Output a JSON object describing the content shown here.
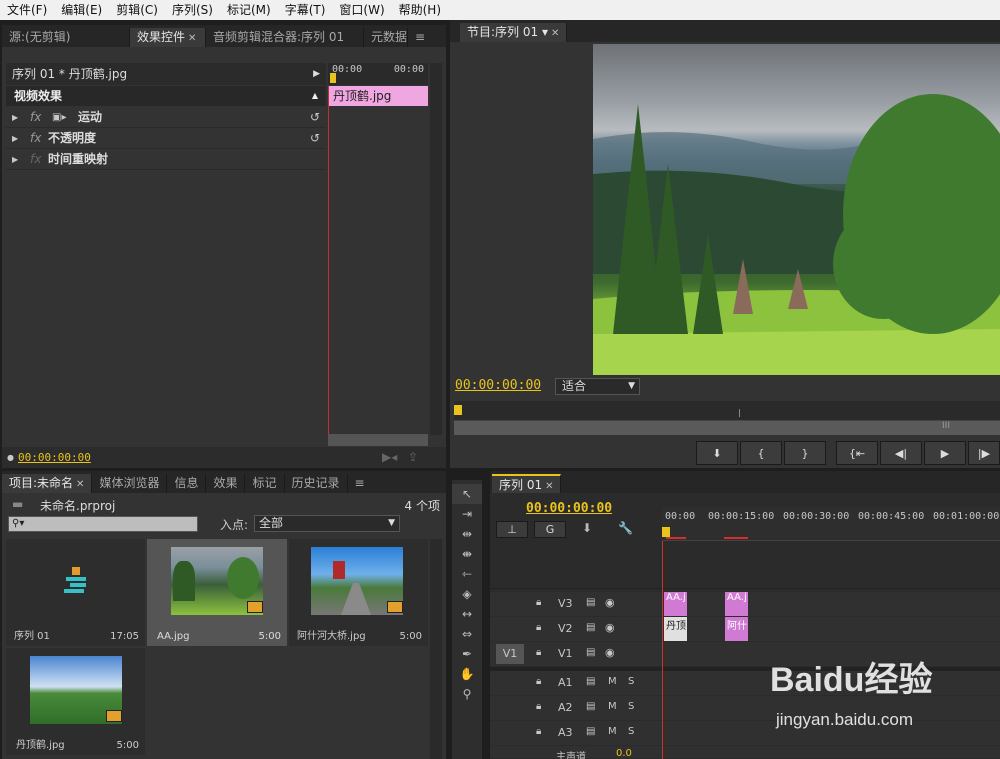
{
  "menu": [
    "文件(F)",
    "编辑(E)",
    "剪辑(C)",
    "序列(S)",
    "标记(M)",
    "字幕(T)",
    "窗口(W)",
    "帮助(H)"
  ],
  "source_panel": {
    "tabs": [
      "源:(无剪辑)",
      "效果控件",
      "音频剪辑混合器:序列 01",
      "元数据"
    ],
    "clip_header": "序列 01 * 丹顶鹤.jpg",
    "ruler_start": "00:00",
    "ruler_end": "00:00",
    "clip_bar": "丹顶鹤.jpg",
    "section_title": "视频效果",
    "effects": [
      {
        "fx": "fx",
        "name": "运动"
      },
      {
        "fx": "fx",
        "name": "不透明度"
      },
      {
        "fx": "fx",
        "name": "时间重映射"
      }
    ],
    "timecode": "00:00:00:00"
  },
  "program_panel": {
    "tab": "节目:序列 01",
    "timecode": "00:00:00:00",
    "fit": "适合",
    "scroll_label": "III"
  },
  "project_panel": {
    "tabs": [
      "项目:未命名",
      "媒体浏览器",
      "信息",
      "效果",
      "标记",
      "历史记录"
    ],
    "project_file": "未命名.prproj",
    "item_count": "4 个项",
    "in_point_label": "入点:",
    "in_point_value": "全部",
    "items": [
      {
        "name": "序列 01",
        "duration": "17:05"
      },
      {
        "name": "AA.jpg",
        "duration": "5:00"
      },
      {
        "name": "阿什河大桥.jpg",
        "duration": "5:00"
      },
      {
        "name": "丹顶鹤.jpg",
        "duration": "5:00"
      }
    ]
  },
  "timeline_panel": {
    "tab": "序列 01",
    "timecode": "00:00:00:00",
    "ruler": [
      "00:00",
      "00:00:15:00",
      "00:00:30:00",
      "00:00:45:00",
      "00:01:00:00"
    ],
    "video_tracks": [
      {
        "name": "V3",
        "clips": [
          "AA.j",
          "AA.j"
        ]
      },
      {
        "name": "V2",
        "clips": [
          "丹顶",
          "阿什"
        ]
      },
      {
        "name": "V1",
        "clips": []
      }
    ],
    "source_patch": "V1",
    "audio_tracks": [
      {
        "name": "A1",
        "m": "M",
        "s": "S"
      },
      {
        "name": "A2",
        "m": "M",
        "s": "S"
      },
      {
        "name": "A3",
        "m": "M",
        "s": "S"
      }
    ],
    "master": {
      "name": "主声道",
      "value": "0.0"
    }
  },
  "watermark": {
    "brand": "Baidu经验",
    "url": "jingyan.baidu.com"
  }
}
